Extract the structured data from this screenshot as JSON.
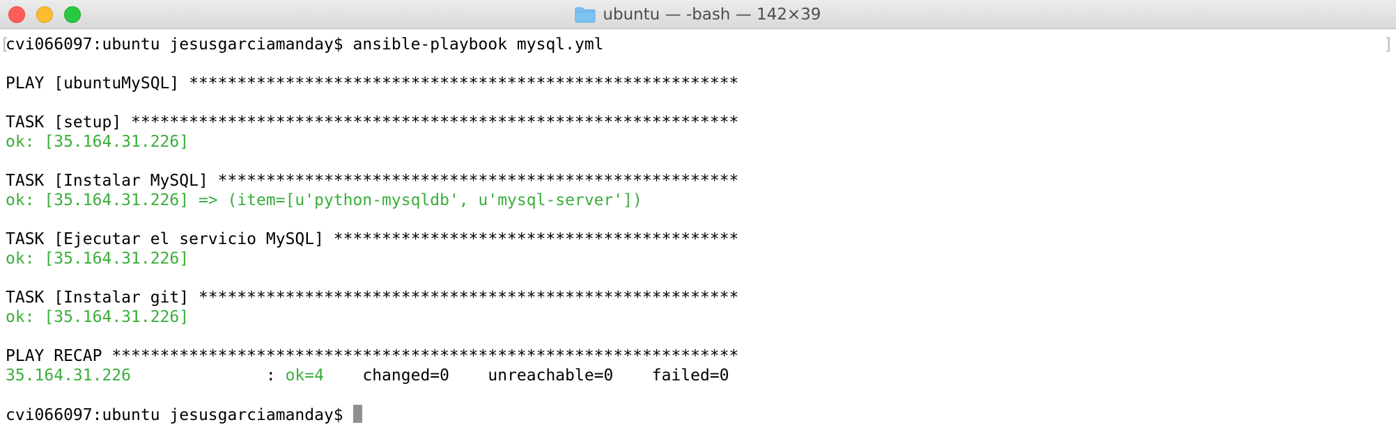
{
  "window": {
    "title": "ubuntu — -bash — 142×39",
    "folder_icon": "folder-icon"
  },
  "terminal": {
    "command_prompt": "cvi066097:ubuntu jesusgarciamanday$ ",
    "command": "ansible-playbook mysql.yml",
    "lines": {
      "play_header": "PLAY [ubuntuMySQL] *********************************************************",
      "task_setup": "TASK [setup] ***************************************************************",
      "task_setup_result": "ok: [35.164.31.226]",
      "task_install_mysql": "TASK [Instalar MySQL] ******************************************************",
      "task_install_mysql_result": "ok: [35.164.31.226] => (item=[u'python-mysqldb', u'mysql-server'])",
      "task_run_mysql": "TASK [Ejecutar el servicio MySQL] ******************************************",
      "task_run_mysql_result": "ok: [35.164.31.226]",
      "task_install_git": "TASK [Instalar git] ********************************************************",
      "task_install_git_result": "ok: [35.164.31.226]",
      "play_recap": "PLAY RECAP *****************************************************************",
      "recap_host": "35.164.31.226              ",
      "recap_sep": ": ",
      "recap_ok": "ok=4",
      "recap_rest": "    changed=0    unreachable=0    failed=0"
    },
    "final_prompt": "cvi066097:ubuntu jesusgarciamanday$ "
  },
  "colors": {
    "ok_green": "#3aad3a",
    "text": "#000000",
    "cursor": "#909090"
  }
}
